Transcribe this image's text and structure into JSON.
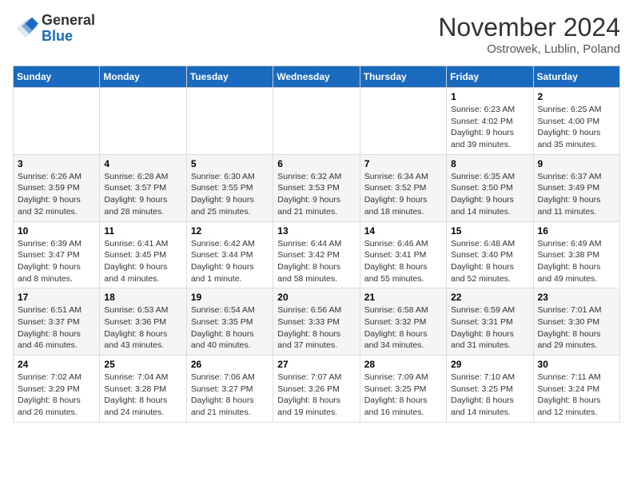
{
  "header": {
    "logo_general": "General",
    "logo_blue": "Blue",
    "month_title": "November 2024",
    "subtitle": "Ostrowek, Lublin, Poland"
  },
  "days_of_week": [
    "Sunday",
    "Monday",
    "Tuesday",
    "Wednesday",
    "Thursday",
    "Friday",
    "Saturday"
  ],
  "weeks": [
    [
      {
        "day": "",
        "info": ""
      },
      {
        "day": "",
        "info": ""
      },
      {
        "day": "",
        "info": ""
      },
      {
        "day": "",
        "info": ""
      },
      {
        "day": "",
        "info": ""
      },
      {
        "day": "1",
        "info": "Sunrise: 6:23 AM\nSunset: 4:02 PM\nDaylight: 9 hours and 39 minutes."
      },
      {
        "day": "2",
        "info": "Sunrise: 6:25 AM\nSunset: 4:00 PM\nDaylight: 9 hours and 35 minutes."
      }
    ],
    [
      {
        "day": "3",
        "info": "Sunrise: 6:26 AM\nSunset: 3:59 PM\nDaylight: 9 hours and 32 minutes."
      },
      {
        "day": "4",
        "info": "Sunrise: 6:28 AM\nSunset: 3:57 PM\nDaylight: 9 hours and 28 minutes."
      },
      {
        "day": "5",
        "info": "Sunrise: 6:30 AM\nSunset: 3:55 PM\nDaylight: 9 hours and 25 minutes."
      },
      {
        "day": "6",
        "info": "Sunrise: 6:32 AM\nSunset: 3:53 PM\nDaylight: 9 hours and 21 minutes."
      },
      {
        "day": "7",
        "info": "Sunrise: 6:34 AM\nSunset: 3:52 PM\nDaylight: 9 hours and 18 minutes."
      },
      {
        "day": "8",
        "info": "Sunrise: 6:35 AM\nSunset: 3:50 PM\nDaylight: 9 hours and 14 minutes."
      },
      {
        "day": "9",
        "info": "Sunrise: 6:37 AM\nSunset: 3:49 PM\nDaylight: 9 hours and 11 minutes."
      }
    ],
    [
      {
        "day": "10",
        "info": "Sunrise: 6:39 AM\nSunset: 3:47 PM\nDaylight: 9 hours and 8 minutes."
      },
      {
        "day": "11",
        "info": "Sunrise: 6:41 AM\nSunset: 3:45 PM\nDaylight: 9 hours and 4 minutes."
      },
      {
        "day": "12",
        "info": "Sunrise: 6:42 AM\nSunset: 3:44 PM\nDaylight: 9 hours and 1 minute."
      },
      {
        "day": "13",
        "info": "Sunrise: 6:44 AM\nSunset: 3:42 PM\nDaylight: 8 hours and 58 minutes."
      },
      {
        "day": "14",
        "info": "Sunrise: 6:46 AM\nSunset: 3:41 PM\nDaylight: 8 hours and 55 minutes."
      },
      {
        "day": "15",
        "info": "Sunrise: 6:48 AM\nSunset: 3:40 PM\nDaylight: 8 hours and 52 minutes."
      },
      {
        "day": "16",
        "info": "Sunrise: 6:49 AM\nSunset: 3:38 PM\nDaylight: 8 hours and 49 minutes."
      }
    ],
    [
      {
        "day": "17",
        "info": "Sunrise: 6:51 AM\nSunset: 3:37 PM\nDaylight: 8 hours and 46 minutes."
      },
      {
        "day": "18",
        "info": "Sunrise: 6:53 AM\nSunset: 3:36 PM\nDaylight: 8 hours and 43 minutes."
      },
      {
        "day": "19",
        "info": "Sunrise: 6:54 AM\nSunset: 3:35 PM\nDaylight: 8 hours and 40 minutes."
      },
      {
        "day": "20",
        "info": "Sunrise: 6:56 AM\nSunset: 3:33 PM\nDaylight: 8 hours and 37 minutes."
      },
      {
        "day": "21",
        "info": "Sunrise: 6:58 AM\nSunset: 3:32 PM\nDaylight: 8 hours and 34 minutes."
      },
      {
        "day": "22",
        "info": "Sunrise: 6:59 AM\nSunset: 3:31 PM\nDaylight: 8 hours and 31 minutes."
      },
      {
        "day": "23",
        "info": "Sunrise: 7:01 AM\nSunset: 3:30 PM\nDaylight: 8 hours and 29 minutes."
      }
    ],
    [
      {
        "day": "24",
        "info": "Sunrise: 7:02 AM\nSunset: 3:29 PM\nDaylight: 8 hours and 26 minutes."
      },
      {
        "day": "25",
        "info": "Sunrise: 7:04 AM\nSunset: 3:28 PM\nDaylight: 8 hours and 24 minutes."
      },
      {
        "day": "26",
        "info": "Sunrise: 7:06 AM\nSunset: 3:27 PM\nDaylight: 8 hours and 21 minutes."
      },
      {
        "day": "27",
        "info": "Sunrise: 7:07 AM\nSunset: 3:26 PM\nDaylight: 8 hours and 19 minutes."
      },
      {
        "day": "28",
        "info": "Sunrise: 7:09 AM\nSunset: 3:25 PM\nDaylight: 8 hours and 16 minutes."
      },
      {
        "day": "29",
        "info": "Sunrise: 7:10 AM\nSunset: 3:25 PM\nDaylight: 8 hours and 14 minutes."
      },
      {
        "day": "30",
        "info": "Sunrise: 7:11 AM\nSunset: 3:24 PM\nDaylight: 8 hours and 12 minutes."
      }
    ]
  ]
}
